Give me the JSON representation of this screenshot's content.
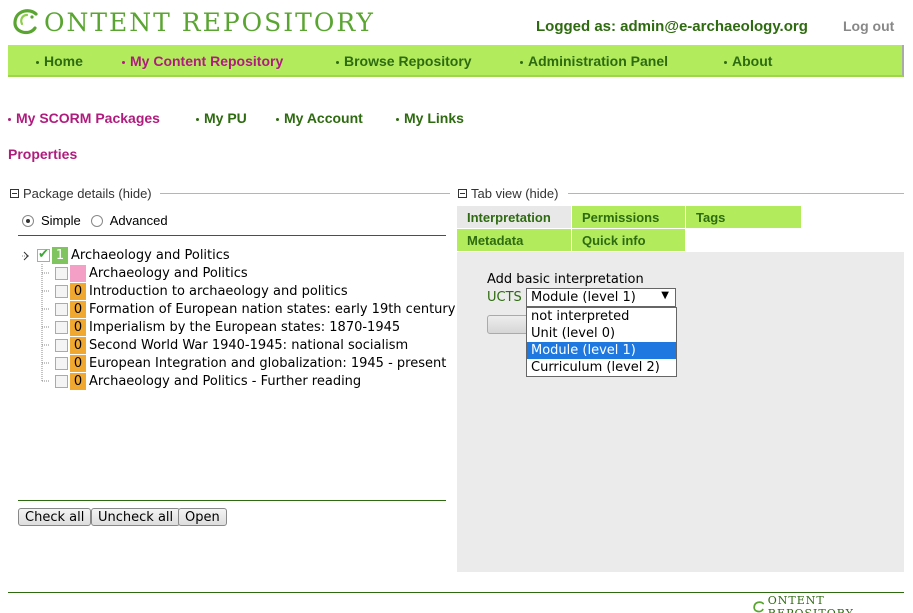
{
  "header": {
    "logo_text": "ONTENT REPOSITORY",
    "logged_as": "Logged as: admin@e-archaeology.org",
    "logout": "Log out"
  },
  "main_nav": [
    {
      "label": "Home",
      "active": false
    },
    {
      "label": "My Content Repository",
      "active": true
    },
    {
      "label": "Browse Repository",
      "active": false
    },
    {
      "label": "Administration Panel",
      "active": false
    },
    {
      "label": "About",
      "active": false
    }
  ],
  "sub_nav": [
    {
      "label": "My SCORM Packages",
      "active": true
    },
    {
      "label": "My PU",
      "active": false
    },
    {
      "label": "My Account",
      "active": false
    },
    {
      "label": "My Links",
      "active": false
    }
  ],
  "page_title": "Properties",
  "package_details": {
    "header": "Package details (hide)",
    "view_modes": [
      {
        "label": "Simple",
        "checked": true
      },
      {
        "label": "Advanced",
        "checked": false
      }
    ],
    "tree": {
      "root": {
        "label": "Archaeology and Politics",
        "badge": "1",
        "checked": true
      },
      "children": [
        {
          "label": "Archaeology and Politics",
          "badge": "",
          "badge_color": "pink"
        },
        {
          "label": "Introduction to archaeology and politics",
          "badge": "0",
          "badge_color": "orange"
        },
        {
          "label": "Formation of European nation states: early 19th century",
          "badge": "0",
          "badge_color": "orange"
        },
        {
          "label": "Imperialism by the European states: 1870-1945",
          "badge": "0",
          "badge_color": "orange"
        },
        {
          "label": "Second World War 1940-1945: national socialism",
          "badge": "0",
          "badge_color": "orange"
        },
        {
          "label": "European Integration and globalization: 1945 - present",
          "badge": "0",
          "badge_color": "orange"
        },
        {
          "label": "Archaeology and Politics - Further reading",
          "badge": "0",
          "badge_color": "orange"
        }
      ]
    },
    "buttons": {
      "check_all": "Check all",
      "uncheck_all": "Uncheck all",
      "open": "Open"
    }
  },
  "tab_view": {
    "header": "Tab view (hide)",
    "tabs": [
      {
        "label": "Interpretation",
        "active": true
      },
      {
        "label": "Permissions",
        "active": false
      },
      {
        "label": "Tags",
        "active": false
      },
      {
        "label": "Metadata",
        "active": false
      },
      {
        "label": "Quick info",
        "active": false
      }
    ],
    "interpretation": {
      "add_label": "Add basic interpretation",
      "ucts_label": "UCTS",
      "selected": "Module (level 1)",
      "options": [
        "not interpreted",
        "Unit (level 0)",
        "Module (level 1)",
        "Curriculum (level 2)"
      ],
      "highlighted_index": 2
    }
  },
  "footer": {
    "logo_text": "ONTENT REPOSITORY"
  },
  "colors": {
    "nav_green": "#b2ec5d",
    "text_green": "#2e6b10",
    "accent_magenta": "#b01c7e",
    "badge_orange": "#f0a830",
    "badge_green": "#80c45f",
    "badge_pink": "#f4a0c6",
    "selected_blue": "#1e78e0"
  }
}
